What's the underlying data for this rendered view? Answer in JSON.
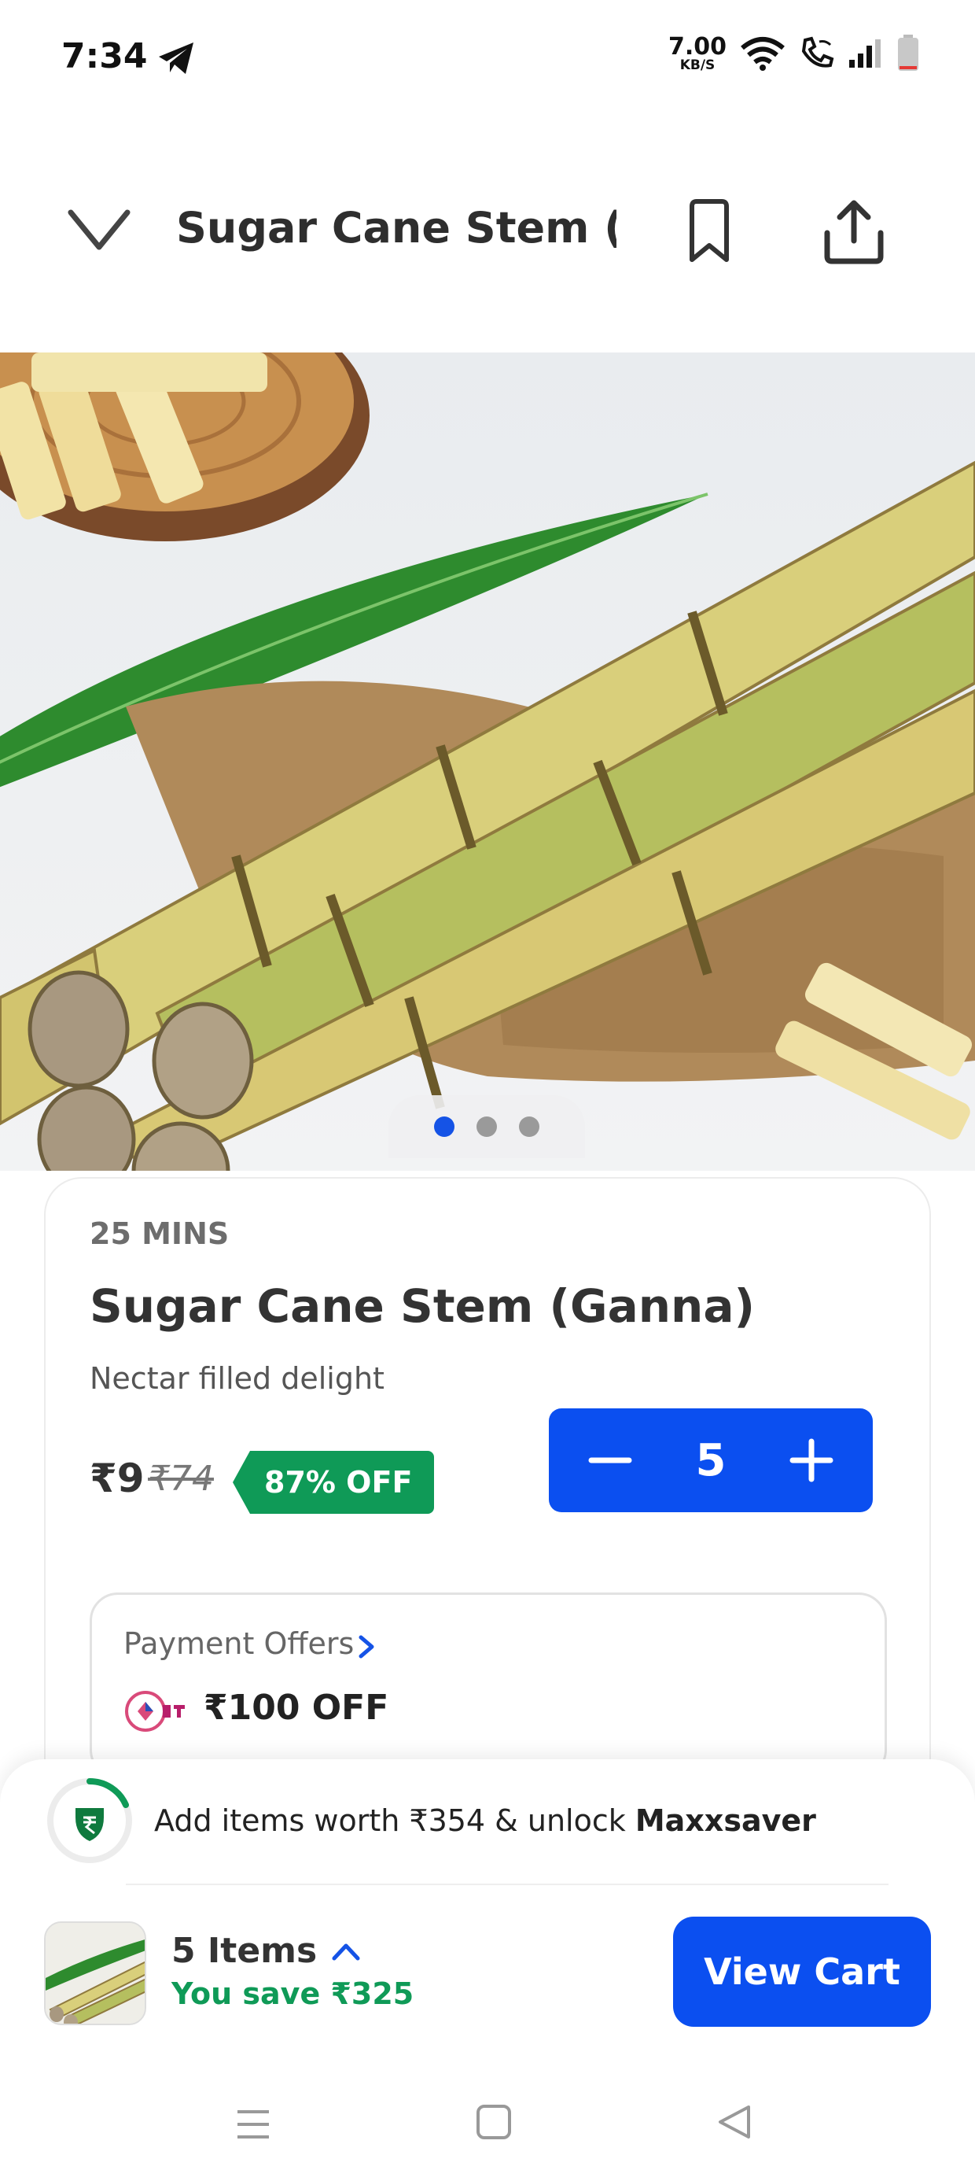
{
  "status_bar": {
    "time": "7:34",
    "speed_value": "7.00",
    "speed_unit": "KB/S",
    "icons": [
      "telegram-icon",
      "wifi-icon",
      "wifi-call-icon",
      "signal-icon",
      "battery-icon"
    ]
  },
  "header": {
    "title": "Sugar Cane Stem (...",
    "icons": [
      "chevron-down-icon",
      "bookmark-icon",
      "share-icon"
    ]
  },
  "carousel": {
    "total": 3,
    "active_index": 0
  },
  "product": {
    "delivery_time": "25 MINS",
    "name": "Sugar Cane Stem (Ganna)",
    "subtitle": "Nectar filled delight",
    "price": "₹9",
    "mrp": "₹74",
    "discount": "87% OFF",
    "quantity": "5"
  },
  "payment_offers": {
    "label": "Payment Offers",
    "offer_amount": "₹100 OFF"
  },
  "bottom_sheet": {
    "unlock_prefix": "Add items worth ₹354 & unlock ",
    "unlock_brand": "Maxxsaver",
    "item_count": "5 Items",
    "savings": "You save ₹325",
    "view_cart_label": "View Cart"
  },
  "colors": {
    "primary_blue": "#0b4ff0",
    "discount_green": "#0f9a57",
    "text_dark": "#2e2e2e"
  }
}
